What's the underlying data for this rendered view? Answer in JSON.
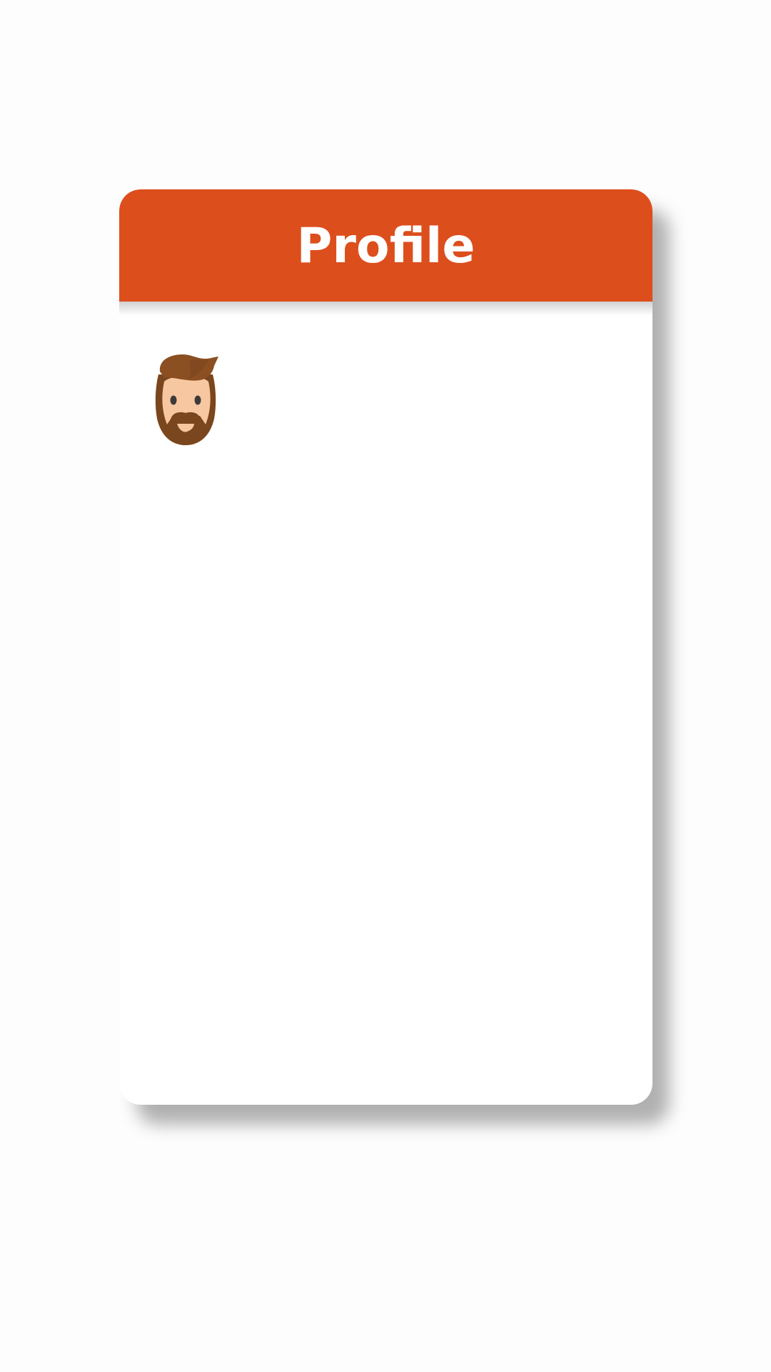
{
  "card": {
    "title": "Profile"
  },
  "avatar": {
    "icon": "bearded-man-avatar-icon"
  },
  "colors": {
    "header": "#dd4e1d",
    "hair": "#8b4f22",
    "beard": "#7a461d",
    "skin": "#f6c7a0",
    "eyes": "#3d3a3a"
  }
}
